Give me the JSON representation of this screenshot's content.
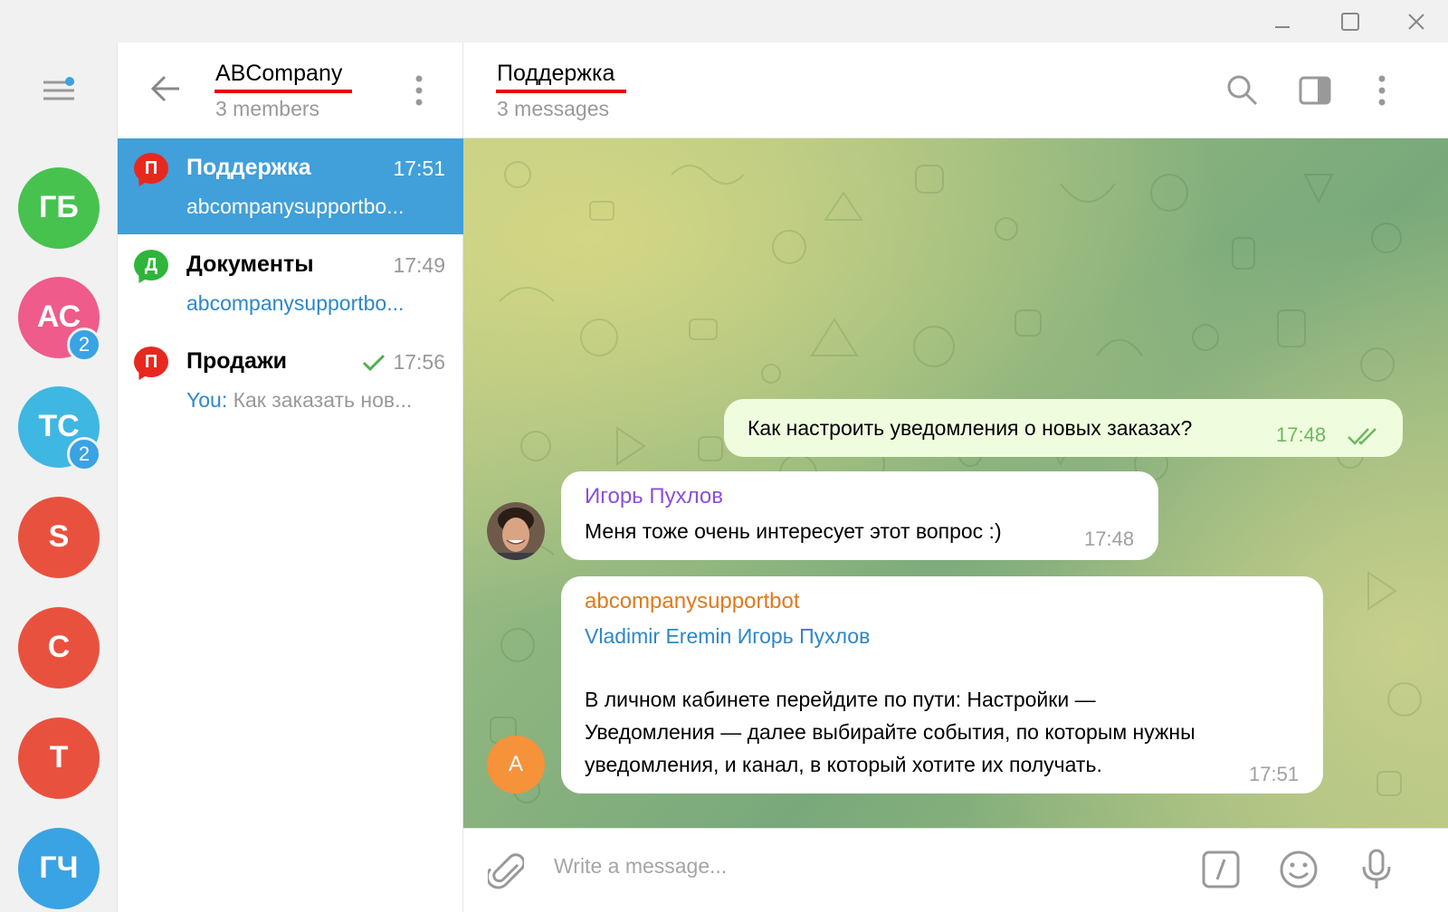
{
  "window": {
    "controls": [
      "minimize-icon",
      "maximize-icon",
      "close-icon"
    ]
  },
  "accounts": [
    {
      "initials": "ГБ",
      "color": "#47c24f",
      "badge": ""
    },
    {
      "initials": "АС",
      "color": "#ef5b8a",
      "badge": "2"
    },
    {
      "initials": "ТС",
      "color": "#3fb7e3",
      "badge": "2"
    },
    {
      "initials": "S",
      "color": "#e9513f",
      "badge": ""
    },
    {
      "initials": "C",
      "color": "#e9513f",
      "badge": ""
    },
    {
      "initials": "T",
      "color": "#e9513f",
      "badge": ""
    },
    {
      "initials": "ГЧ",
      "color": "#3aa3e3",
      "badge": ""
    }
  ],
  "chatlist": {
    "title": "ABCompany",
    "subtitle": "3 members",
    "chats": [
      {
        "icon_letter": "П",
        "icon_color": "#e8281e",
        "name": "Поддержка",
        "time": "17:51",
        "preview_sender": "",
        "preview": "abcompanysupportbo...",
        "active": true,
        "read_check": false
      },
      {
        "icon_letter": "Д",
        "icon_color": "#2fb53a",
        "name": "Документы",
        "time": "17:49",
        "preview_sender": "",
        "preview": "abcompanysupportbo...",
        "active": false,
        "read_check": false
      },
      {
        "icon_letter": "П",
        "icon_color": "#e8281e",
        "name": "Продажи",
        "time": "17:56",
        "preview_sender": "You:",
        "preview": " Как заказать нов...",
        "active": false,
        "read_check": true
      }
    ]
  },
  "conversation": {
    "title": "Поддержка",
    "subtitle": "3 messages",
    "messages": [
      {
        "direction": "out",
        "text": "Как настроить уведомления о новых заказах?",
        "time": "17:48"
      },
      {
        "direction": "in",
        "sender": "Игорь Пухлов",
        "sender_color": "#8a4fd8",
        "text": "Меня тоже очень интересует этот вопрос :)",
        "time": "17:48"
      },
      {
        "direction": "in",
        "sender": "abcompanysupportbot",
        "sender_color": "#e07a1c",
        "mentions": "Vladimir Eremin Игорь Пухлов",
        "mentions_color": "#2d87c9",
        "lines": [
          "В личном кабинете перейдите по пути: Настройки —",
          "Уведомления — далее выбирайте события, по которым нужны",
          "уведомления, и канал, в который хотите их получать."
        ],
        "time": "17:51",
        "avatar_letter": "A",
        "avatar_color": "#f5923a"
      }
    ]
  },
  "composer": {
    "placeholder": "Write a message..."
  }
}
